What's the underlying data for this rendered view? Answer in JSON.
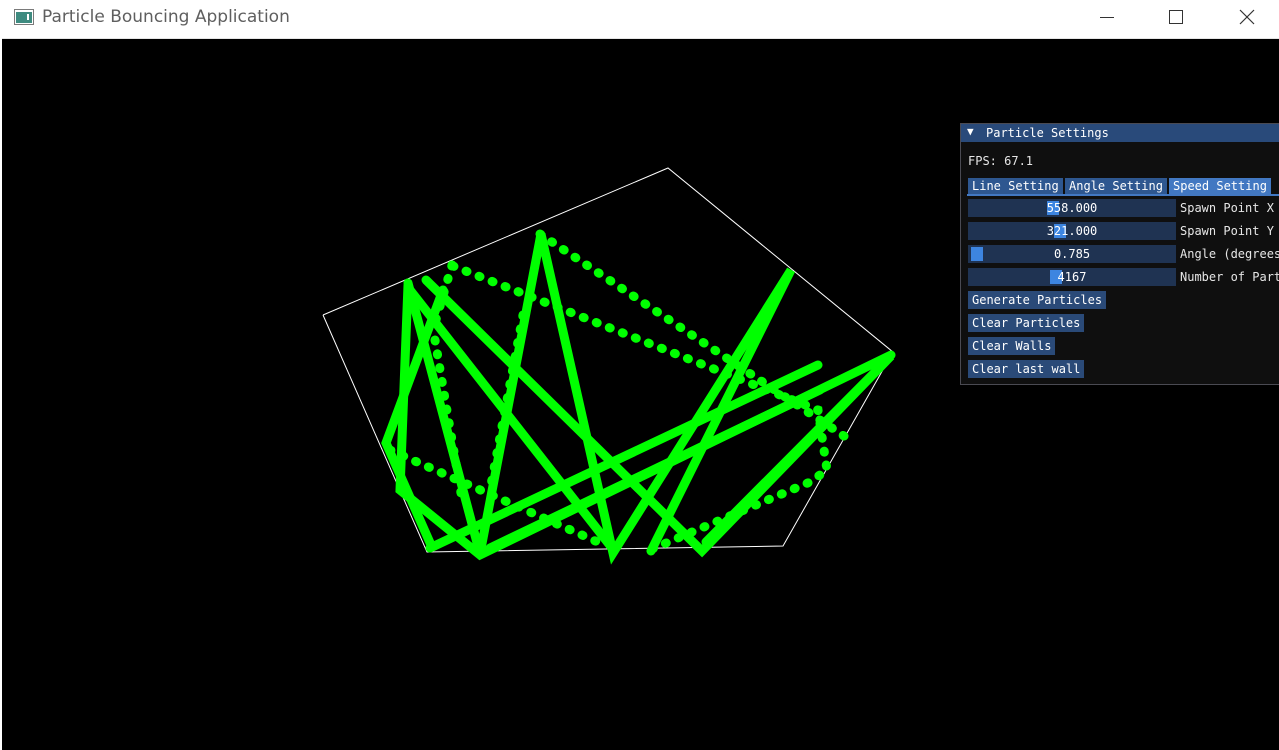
{
  "window": {
    "title": "Particle Bouncing Application"
  },
  "panel": {
    "arrow": "▼",
    "title": "Particle Settings",
    "fps": "FPS: 67.1",
    "tabs": [
      {
        "label": "Line Setting"
      },
      {
        "label": "Angle Setting"
      },
      {
        "label": "Speed Setting"
      }
    ],
    "sliders": [
      {
        "value": "558.000",
        "label": "Spawn Point X"
      },
      {
        "value": "321.000",
        "label": "Spawn Point Y"
      },
      {
        "value": "0.785",
        "label": "Angle (degrees"
      },
      {
        "value": "4167",
        "label": "Number of Part"
      }
    ],
    "buttons": [
      {
        "label": "Generate Particles"
      },
      {
        "label": "Clear Particles"
      },
      {
        "label": "Clear Walls"
      },
      {
        "label": "Clear last wall"
      }
    ]
  },
  "colors": {
    "particles": "#00ff00",
    "walls": "#ffffff",
    "panel_header": "#294a7a",
    "tab": "#2e5790",
    "tab_active": "#4278c2",
    "slider_bg": "#1f3352",
    "slider_grab": "#3d85e0",
    "button": "#2a4a78"
  }
}
